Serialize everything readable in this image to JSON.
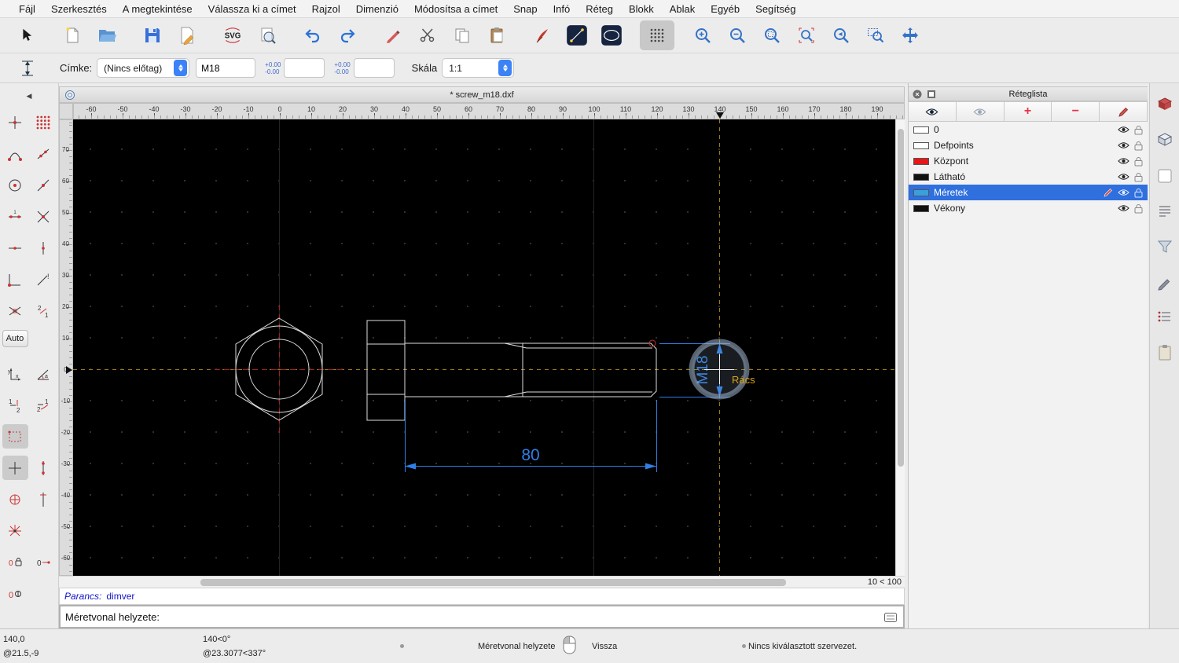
{
  "menu": {
    "items": [
      "Fájl",
      "Szerkesztés",
      "A megtekintése",
      "Válassza ki a címet",
      "Rajzol",
      "Dimenzió",
      "Módosítsa a címet",
      "Snap",
      "Infó",
      "Réteg",
      "Blokk",
      "Ablak",
      "Egyéb",
      "Segítség"
    ]
  },
  "toolbar": {
    "svg_label": "SVG"
  },
  "tool_options": {
    "label": "Címke:",
    "prefix": "(Nincs előtag)",
    "value": "M18",
    "tolerance_upper": "+0.00",
    "tolerance_lower": "-0.00",
    "scale_label": "Skála",
    "scale_value": "1:1"
  },
  "document": {
    "title": "* screw_m18.dxf"
  },
  "ruler": {
    "h_ticks": [
      "-60",
      "-50",
      "-40",
      "-30",
      "-20",
      "-10",
      "0",
      "10",
      "20",
      "30",
      "40",
      "50",
      "60",
      "70",
      "80",
      "90",
      "100",
      "110",
      "120",
      "130",
      "140",
      "150",
      "160",
      "170",
      "180",
      "190"
    ],
    "v_ticks": [
      "70",
      "60",
      "50",
      "40",
      "30",
      "20",
      "10",
      "0",
      "-10",
      "-20",
      "-30",
      "-40",
      "-50",
      "-60"
    ]
  },
  "drawing": {
    "dim_length": "80",
    "dim_diameter": "M18",
    "snap_label": "Rács",
    "grid_status": "10 < 100",
    "colors": {
      "dimension_blue": "#2f7fe8",
      "snap_orange": "#9c7a12",
      "centerline_red": "#a02020",
      "geometry_white": "#dddddd"
    }
  },
  "left_toolbar": {
    "auto_label": "Auto"
  },
  "layers_panel": {
    "title": "Réteglista",
    "layers": [
      {
        "name": "0",
        "color": "#ffffff",
        "selected": false
      },
      {
        "name": "Defpoints",
        "color": "#ffffff",
        "selected": false
      },
      {
        "name": "Központ",
        "color": "#e81717",
        "selected": false
      },
      {
        "name": "Látható",
        "color": "#111111",
        "selected": false
      },
      {
        "name": "Méretek",
        "color": "#3aa0dc",
        "selected": true
      },
      {
        "name": "Vékony",
        "color": "#111111",
        "selected": false
      }
    ]
  },
  "command": {
    "prompt": "Parancs:",
    "last": "dimver",
    "current": "Méretvonal helyzete:"
  },
  "status": {
    "abs": "140,0",
    "rel": "@21.5,-9",
    "polar_abs": "140<0°",
    "polar_rel": "@23.3077<337°",
    "left_click": "Méretvonal helyzete",
    "right_click": "Vissza",
    "selection": "Nincs kiválasztott szervezet."
  }
}
